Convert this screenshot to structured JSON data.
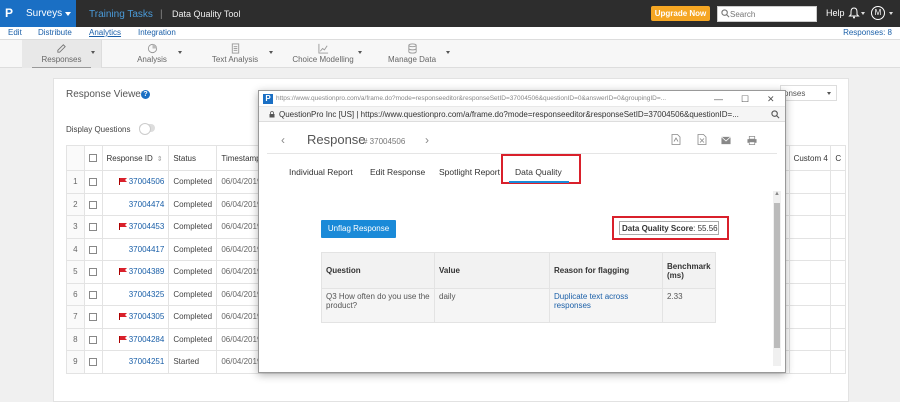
{
  "topbar": {
    "logo": "P",
    "survey_menu": "Surveys",
    "breadcrumb_parent": "Training Tasks",
    "breadcrumb_sep": "|",
    "breadcrumb_current": "Data Quality Tool",
    "upgrade_label": "Upgrade Now",
    "search_placeholder": "Search",
    "help_label": "Help",
    "avatar_initial": "M"
  },
  "menu": {
    "items": [
      "Edit",
      "Distribute",
      "Analytics",
      "Integration"
    ],
    "active_index": 2,
    "responses_count": "Responses: 8"
  },
  "toolbar": {
    "items": [
      "Responses",
      "Analysis",
      "Text Analysis",
      "Choice Modelling",
      "Manage Data"
    ]
  },
  "main": {
    "title": "Response Viewer",
    "help_icon": "?",
    "display_questions_label": "Display Questions",
    "right_select_value": "onses",
    "headers": {
      "response_id": "Response ID",
      "status": "Status",
      "timestamp": "Timestamp",
      "custom4": "Custom 4",
      "last": "C"
    },
    "rows": [
      {
        "n": "1",
        "flag": true,
        "id": "37004506",
        "status": "Completed",
        "ts": "06/04/2019"
      },
      {
        "n": "2",
        "flag": false,
        "id": "37004474",
        "status": "Completed",
        "ts": "06/04/2019"
      },
      {
        "n": "3",
        "flag": true,
        "id": "37004453",
        "status": "Completed",
        "ts": "06/04/2019"
      },
      {
        "n": "4",
        "flag": false,
        "id": "37004417",
        "status": "Completed",
        "ts": "06/04/2019"
      },
      {
        "n": "5",
        "flag": true,
        "id": "37004389",
        "status": "Completed",
        "ts": "06/04/2019"
      },
      {
        "n": "6",
        "flag": false,
        "id": "37004325",
        "status": "Completed",
        "ts": "06/04/2019"
      },
      {
        "n": "7",
        "flag": true,
        "id": "37004305",
        "status": "Completed",
        "ts": "06/04/2019"
      },
      {
        "n": "8",
        "flag": true,
        "id": "37004284",
        "status": "Completed",
        "ts": "06/04/2019"
      },
      {
        "n": "9",
        "flag": false,
        "id": "37004251",
        "status": "Started",
        "ts": "06/04/2019"
      }
    ]
  },
  "popup": {
    "title_url": "https://www.questionpro.com/a/frame.do?mode=responseeditor&responseSetID=37004506&questionID=0&answerID=0&groupingID=...",
    "window_controls": {
      "minimize": "—",
      "maximize": "☐",
      "close": "✕"
    },
    "address": "QuestionPro Inc [US]  |  https://www.questionpro.com/a/frame.do?mode=responseeditor&responseSetID=37004506&questionID=...",
    "nav_back": "‹",
    "nav_forward": "›",
    "title": "Response",
    "response_id": "# 37004506",
    "tabs": [
      "Individual Report",
      "Edit Response",
      "Spotlight Report",
      "Data Quality"
    ],
    "active_tab": 3,
    "unflag_label": "Unflag Response",
    "score_label": "Data Quality Score",
    "score_value": ": 55.56",
    "table": {
      "headers": [
        "Question",
        "Value",
        "Reason for flagging",
        "Benchmark (ms)"
      ],
      "rows": [
        {
          "question": "Q3 How often do you use the product?",
          "value": "daily",
          "reason": "Duplicate text across responses",
          "benchmark": "2.33"
        }
      ]
    }
  },
  "colors": {
    "brand_blue": "#1a6fc4",
    "accent_blue": "#1a8ad8",
    "upgrade_orange": "#f5a623",
    "highlight_red": "#d9202b",
    "flag_red": "#d9202b",
    "topbar_bg": "#2d2d2d"
  }
}
